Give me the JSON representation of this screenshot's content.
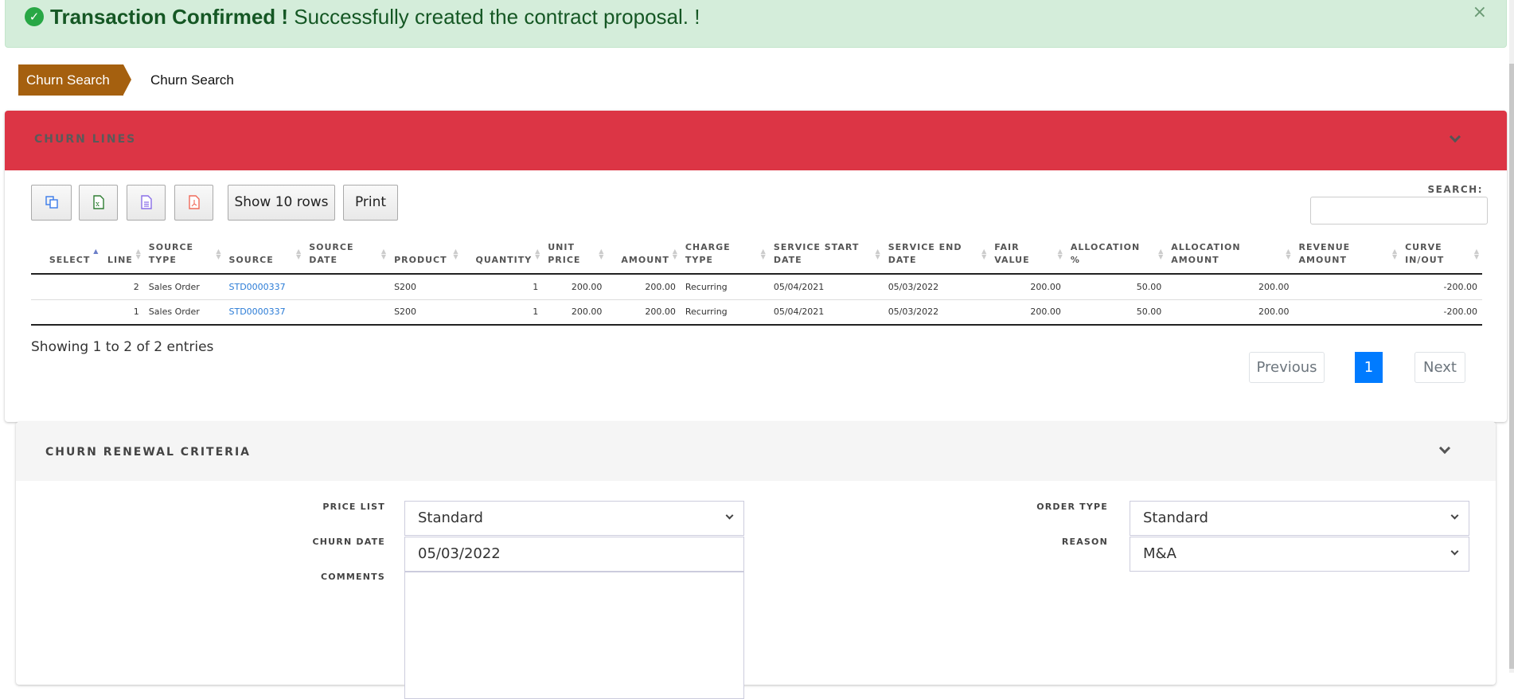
{
  "alert": {
    "icon": "check-circle-icon",
    "title": "Transaction Confirmed !",
    "message": "Successfully created the contract proposal. !",
    "close": "×",
    "color": "#155724",
    "background": "#d4edda"
  },
  "breadcrumb": [
    {
      "label": "Churn Search"
    },
    {
      "label": "Churn Search"
    }
  ],
  "churn_lines": {
    "title": "CHURN LINES",
    "header_color": "#dc3545",
    "toolbar": {
      "copy_icon": "copy-icon",
      "excel_icon": "excel-icon",
      "csv_icon": "csv-icon",
      "pdf_icon": "pdf-icon",
      "show_rows": "Show 10 rows",
      "print": "Print"
    },
    "search": {
      "label": "SEARCH:",
      "value": "",
      "placeholder": ""
    },
    "columns": [
      {
        "l1": "",
        "l2": "SELECT"
      },
      {
        "l1": "",
        "l2": "LINE"
      },
      {
        "l1": "SOURCE",
        "l2": "TYPE"
      },
      {
        "l1": "",
        "l2": "SOURCE"
      },
      {
        "l1": "SOURCE",
        "l2": "DATE"
      },
      {
        "l1": "",
        "l2": "PRODUCT"
      },
      {
        "l1": "",
        "l2": "QUANTITY"
      },
      {
        "l1": "UNIT",
        "l2": "PRICE"
      },
      {
        "l1": "",
        "l2": "AMOUNT"
      },
      {
        "l1": "CHARGE",
        "l2": "TYPE"
      },
      {
        "l1": "SERVICE START",
        "l2": "DATE"
      },
      {
        "l1": "SERVICE END",
        "l2": "DATE"
      },
      {
        "l1": "FAIR",
        "l2": "VALUE"
      },
      {
        "l1": "ALLOCATION",
        "l2": "%"
      },
      {
        "l1": "ALLOCATION",
        "l2": "AMOUNT"
      },
      {
        "l1": "REVENUE",
        "l2": "AMOUNT"
      },
      {
        "l1": "CURVE",
        "l2": "IN/OUT"
      }
    ],
    "rows": [
      {
        "select": "",
        "line": "2",
        "source_type": "Sales Order",
        "source": "STD0000337",
        "source_date": "",
        "product": "S200",
        "quantity": "1",
        "unit_price": "200.00",
        "amount": "200.00",
        "charge_type": "Recurring",
        "service_start": "05/04/2021",
        "service_end": "05/03/2022",
        "fair_value": "200.00",
        "allocation_pct": "50.00",
        "allocation_amount": "200.00",
        "revenue_amount": "",
        "curve": "-200.00"
      },
      {
        "select": "",
        "line": "1",
        "source_type": "Sales Order",
        "source": "STD0000337",
        "source_date": "",
        "product": "S200",
        "quantity": "1",
        "unit_price": "200.00",
        "amount": "200.00",
        "charge_type": "Recurring",
        "service_start": "05/04/2021",
        "service_end": "05/03/2022",
        "fair_value": "200.00",
        "allocation_pct": "50.00",
        "allocation_amount": "200.00",
        "revenue_amount": "",
        "curve": "-200.00"
      }
    ],
    "info": "Showing 1 to 2 of 2 entries",
    "pagination": {
      "previous": "Previous",
      "current": "1",
      "next": "Next",
      "active_color": "#007bff"
    }
  },
  "renewal": {
    "title": "CHURN RENEWAL CRITERIA",
    "price_list": {
      "label": "PRICE LIST",
      "value": "Standard"
    },
    "churn_date": {
      "label": "CHURN DATE",
      "value": "05/03/2022"
    },
    "comments": {
      "label": "COMMENTS",
      "value": ""
    },
    "order_type": {
      "label": "ORDER TYPE",
      "value": "Standard"
    },
    "reason": {
      "label": "REASON",
      "value": "M&A"
    }
  }
}
